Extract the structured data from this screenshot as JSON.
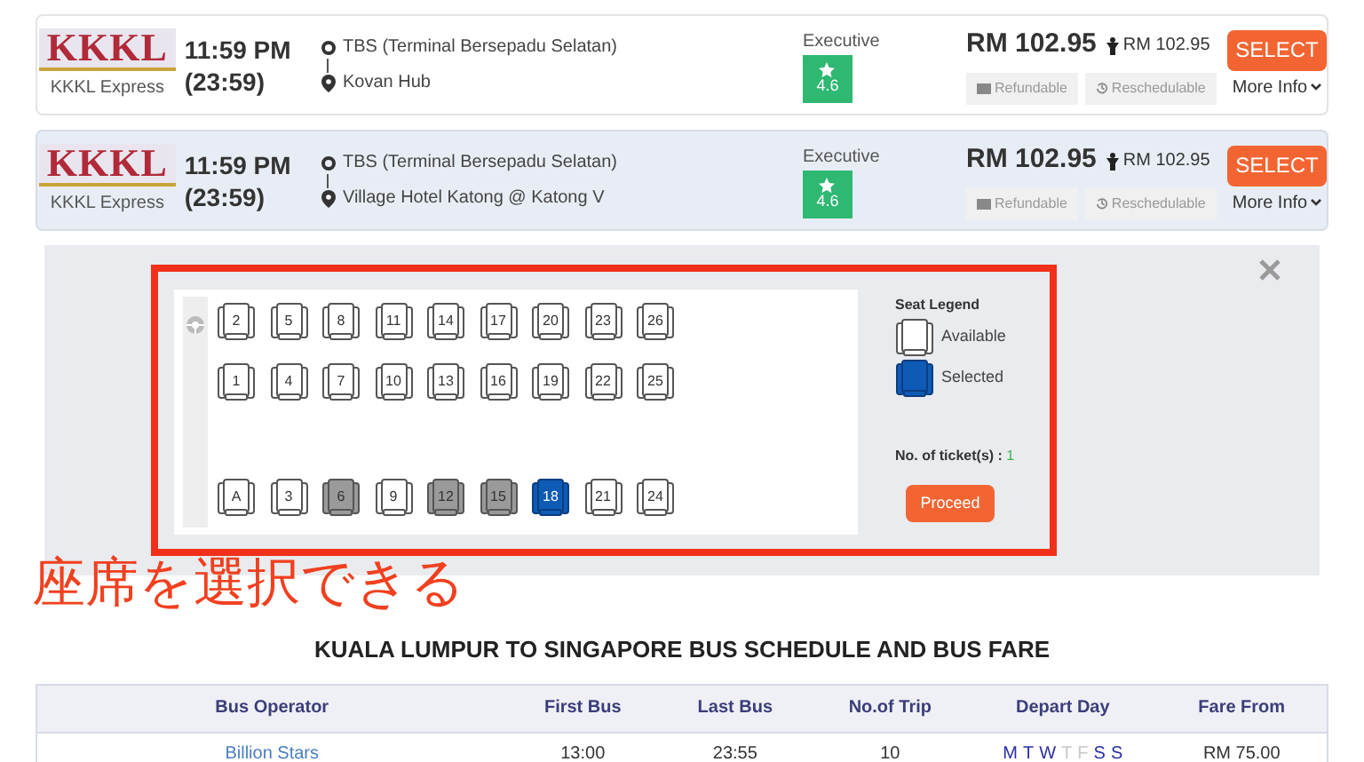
{
  "trips": [
    {
      "operator": "KKKL Express",
      "logo": "KKKL",
      "time": "11:59 PM",
      "time24": "(23:59)",
      "from": "TBS (Terminal Bersepadu Selatan)",
      "to": "Kovan Hub",
      "class": "Executive",
      "rating": "4.6",
      "price": "RM 102.95",
      "seat_price": "RM 102.95",
      "tags": [
        "Refundable",
        "Reschedulable"
      ],
      "button": "SELECT",
      "more": "More Info",
      "selected": false
    },
    {
      "operator": "KKKL Express",
      "logo": "KKKL",
      "time": "11:59 PM",
      "time24": "(23:59)",
      "from": "TBS (Terminal Bersepadu Selatan)",
      "to": "Village Hotel Katong @ Katong V",
      "class": "Executive",
      "rating": "4.6",
      "price": "RM 102.95",
      "seat_price": "RM 102.95",
      "tags": [
        "Refundable",
        "Reschedulable"
      ],
      "button": "SELECT",
      "more": "More Info",
      "selected": true
    }
  ],
  "seat_map": {
    "rows": [
      [
        {
          "label": "2",
          "booked": false,
          "selected": false
        },
        {
          "label": "5",
          "booked": false,
          "selected": false
        },
        {
          "label": "8",
          "booked": false,
          "selected": false
        },
        {
          "label": "11",
          "booked": false,
          "selected": false
        },
        {
          "label": "14",
          "booked": false,
          "selected": false
        },
        {
          "label": "17",
          "booked": false,
          "selected": false
        },
        {
          "label": "20",
          "booked": false,
          "selected": false
        },
        {
          "label": "23",
          "booked": false,
          "selected": false
        },
        {
          "label": "26",
          "booked": false,
          "selected": false
        }
      ],
      [
        {
          "label": "1",
          "booked": false,
          "selected": false
        },
        {
          "label": "4",
          "booked": false,
          "selected": false
        },
        {
          "label": "7",
          "booked": false,
          "selected": false
        },
        {
          "label": "10",
          "booked": false,
          "selected": false
        },
        {
          "label": "13",
          "booked": false,
          "selected": false
        },
        {
          "label": "16",
          "booked": false,
          "selected": false
        },
        {
          "label": "19",
          "booked": false,
          "selected": false
        },
        {
          "label": "22",
          "booked": false,
          "selected": false
        },
        {
          "label": "25",
          "booked": false,
          "selected": false
        }
      ],
      [
        {
          "label": "A",
          "booked": false,
          "selected": false
        },
        {
          "label": "3",
          "booked": false,
          "selected": false
        },
        {
          "label": "6",
          "booked": true,
          "selected": false
        },
        {
          "label": "9",
          "booked": false,
          "selected": false
        },
        {
          "label": "12",
          "booked": true,
          "selected": false
        },
        {
          "label": "15",
          "booked": true,
          "selected": false
        },
        {
          "label": "18",
          "booked": false,
          "selected": true
        },
        {
          "label": "21",
          "booked": false,
          "selected": false
        },
        {
          "label": "24",
          "booked": false,
          "selected": false
        }
      ]
    ],
    "legend_title": "Seat Legend",
    "legend": [
      {
        "label": "Available",
        "kind": "available"
      },
      {
        "label": "Selected",
        "kind": "selected"
      }
    ],
    "tickets_label": "No. of ticket(s) :",
    "tickets": "1",
    "proceed": "Proceed"
  },
  "annotation": "座席を選択できる",
  "schedule": {
    "title": "KUALA LUMPUR TO SINGAPORE BUS SCHEDULE AND BUS FARE",
    "columns": [
      "Bus Operator",
      "First Bus",
      "Last Bus",
      "No.of Trip",
      "Depart Day",
      "Fare From"
    ],
    "rows": [
      {
        "operator": "Billion Stars",
        "first": "13:00",
        "last": "23:55",
        "trips": "10",
        "days": [
          {
            "day": "M",
            "active": true
          },
          {
            "day": "T",
            "active": true
          },
          {
            "day": "W",
            "active": true
          },
          {
            "day": "T",
            "active": false
          },
          {
            "day": "F",
            "active": false
          },
          {
            "day": "S",
            "active": true
          },
          {
            "day": "S",
            "active": true
          }
        ],
        "fare": "RM 75.00"
      }
    ]
  }
}
